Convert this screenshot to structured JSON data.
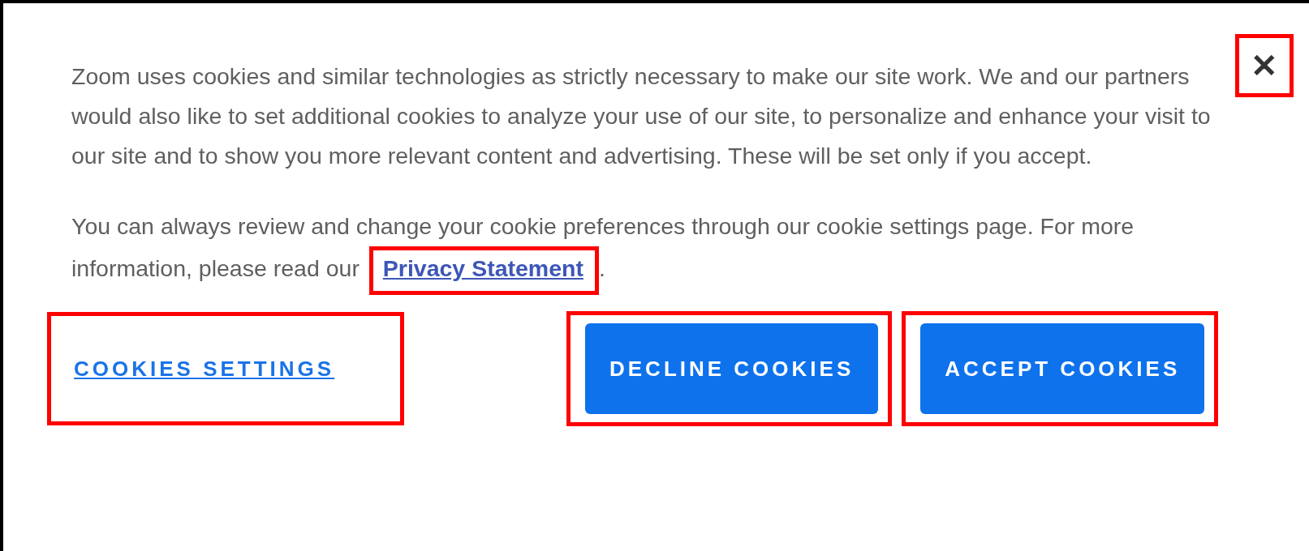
{
  "banner": {
    "message": "Zoom uses cookies and similar technologies as strictly necessary to make our site work. We and our partners would also like to set additional cookies to analyze your use of our site, to personalize and enhance your visit to our site and to show you more relevant content and advertising. These will be set only if you accept.",
    "info": {
      "before": "You can always review and change your cookie preferences through our cookie settings page. For more information, please read our",
      "link": "Privacy Statement",
      "after": "."
    },
    "close": "✕",
    "settings_link": "COOKIES SETTINGS",
    "buttons": [
      {
        "label": "DECLINE COOKIES"
      },
      {
        "label": "ACCEPT COOKIES"
      }
    ]
  }
}
